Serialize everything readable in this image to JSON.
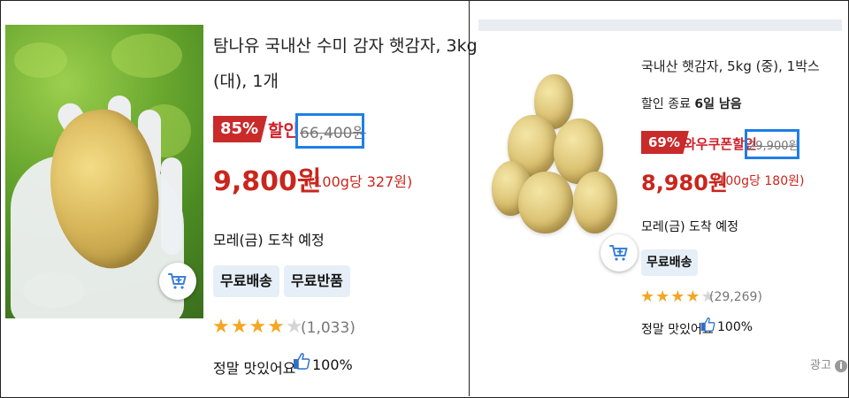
{
  "card1": {
    "title_line1": "탐나유 국내산 수미 감자 햇감자, 3kg",
    "title_line2": "(대), 1개",
    "discount_badge": "85%",
    "discount_label": "할인",
    "original_price": "66,400원",
    "price": "9,800원",
    "unit_price": "(100g당 327원)",
    "delivery": "모레(금) 도착 예정",
    "tags": [
      "무료배송",
      "무료반품"
    ],
    "rating_stars": 4,
    "review_count": "(1,033)",
    "tasty_label": "정말 맛있어요",
    "tasty_percent": "100%",
    "cart_icon": "add-to-cart-icon"
  },
  "card2": {
    "title": "국내산 햇감자, 5kg (중), 1박스",
    "sale_end_prefix": "할인 종료 ",
    "sale_end_days": "6일 남음",
    "discount_badge": "69%",
    "discount_label": "와우쿠폰할인",
    "original_price": "29,900원",
    "price": "8,980원",
    "unit_price": "(100g당 180원)",
    "delivery": "모레(금) 도착 예정",
    "tags": [
      "무료배송"
    ],
    "rating_stars": 4,
    "review_count": "(29,269)",
    "tasty_label": "정말 맛있어요",
    "tasty_percent": "100%",
    "ad_label": "광고",
    "cart_icon": "add-to-cart-icon"
  },
  "colors": {
    "discount_red": "#c92a2a",
    "price_red": "#c9261d",
    "highlight_blue": "#1e7fe6",
    "star_yellow": "#f5a623",
    "tag_bg": "#e6eff7"
  }
}
